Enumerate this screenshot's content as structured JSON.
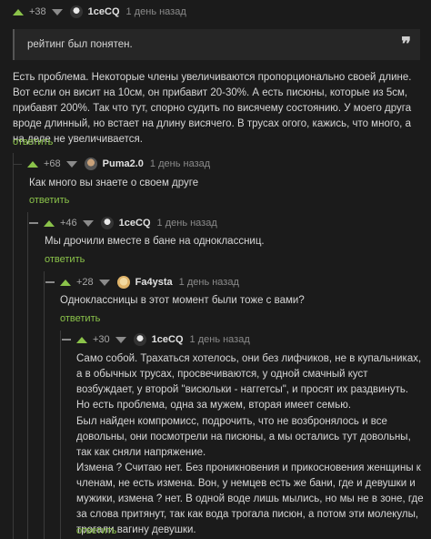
{
  "comments": [
    {
      "rating": "+38",
      "author": "1ceCQ",
      "time": "1 день назад",
      "quote": "рейтинг был понятен.",
      "quote_mark": "❞",
      "body": "Есть проблема. Некоторые члены увеличиваются пропорционально своей длине. Вот если он висит на 10см, он прибавит 20-30%. А есть писюны, которые из 5см, прибавят 200%. Так что тут, спорно судить по висячему состоянию. У моего друга вроде длинный, но встает на длину висячего. В трусах огого, кажись, что много, а на деле не увеличивается.",
      "reply": "ответить"
    },
    {
      "rating": "+68",
      "author": "Puma2.0",
      "time": "1 день назад",
      "body": "Как много вы знаете о своем друге",
      "reply": "ответить"
    },
    {
      "rating": "+46",
      "author": "1ceCQ",
      "time": "1 день назад",
      "body": "Мы дрочили вместе в бане на одноклассниц.",
      "reply": "ответить"
    },
    {
      "rating": "+28",
      "author": "Fa4ysta",
      "time": "1 день назад",
      "body": "Одноклассницы в этот момент были тоже с вами?",
      "reply": "ответить"
    },
    {
      "rating": "+30",
      "author": "1ceCQ",
      "time": "1 день назад",
      "body_lines": [
        "Само собой. Трахаться хотелось, они без лифчиков, не в купальниках, а в обычных трусах, просвечиваются, у одной смачный куст возбуждает, у второй \"висюльки - наггетсы\", и просят их раздвинуть. Но есть проблема, одна за мужем, вторая имеет семью.",
        "Был найден компромисс, подрочить, что не возбронялось и все довольны, они посмотрели на писюны, а мы остались тут довольны, так как сняли напряжение.",
        "Измена ? Считаю нет. Без проникновения и прикосновения женщины к членам, не есть измена. Вон, у немцев есть же бани, где и девушки и мужики, измена ? нет. В одной воде лишь мылись, но мы не в зоне, где за слова притянут, так как вода трогала писюн, а потом эти молекулы, трогали вагину девушки."
      ],
      "reply": "ответить"
    }
  ],
  "colors": {
    "accent": "#8bc34a",
    "background": "#1b1b1b",
    "text": "#d6d6d6"
  },
  "icons": [
    "upvote-icon",
    "downvote-icon",
    "collapse-dash-icon",
    "quote-icon"
  ]
}
